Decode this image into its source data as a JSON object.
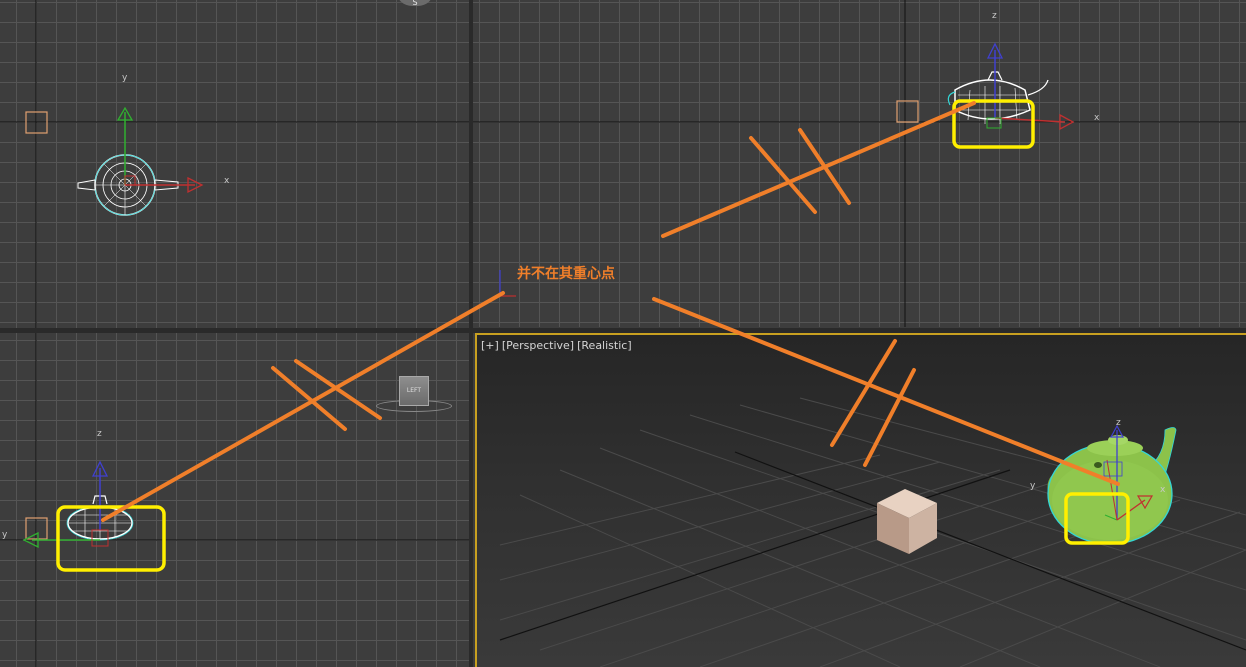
{
  "viewports": {
    "perspective": {
      "plus": "[+]",
      "name": "[Perspective]",
      "shading": "[Realistic]"
    }
  },
  "annotation": {
    "text": "并不在其重心点"
  },
  "navigation": {
    "top_compass": "S",
    "left_cube": "LEFT"
  },
  "axis_labels": {
    "x": "x",
    "y": "y",
    "z": "z"
  },
  "colors": {
    "annotation": "#f07f2a",
    "highlight_box": "#ffef00",
    "active_viewport_border": "#c8a020",
    "selection_wire": "#ffffff",
    "teapot_shaded": "#8cc24a"
  }
}
